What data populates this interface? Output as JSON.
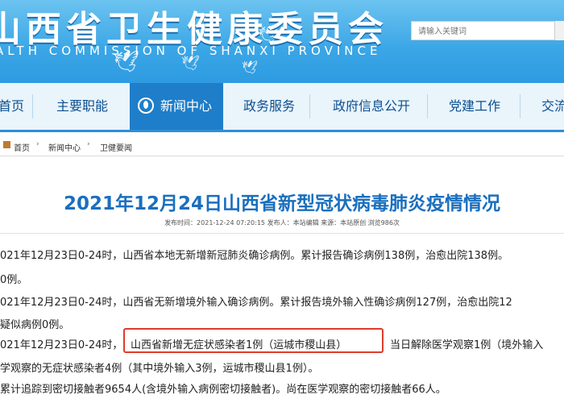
{
  "header": {
    "title_cn": "山西省卫生健康委员会",
    "title_en": "ALTH COMMISSION OF SHANXI PROVINCE",
    "search_placeholder": "请输入关键词"
  },
  "nav": {
    "items": [
      {
        "label": "首页"
      },
      {
        "label": "主要职能"
      },
      {
        "label": "新闻中心",
        "active": true
      },
      {
        "label": "政务服务"
      },
      {
        "label": "政府信息公开"
      },
      {
        "label": "党建工作"
      },
      {
        "label": "交流"
      }
    ]
  },
  "breadcrumb": {
    "items": [
      "首页",
      "新闻中心",
      "卫健要闻"
    ]
  },
  "article": {
    "title": "2021年12月24日山西省新型冠状病毒肺炎疫情情况",
    "meta": "发布时间：2021-12-24 07:20:15  发布人：本站编辑  来源：本站原创  浏览986次",
    "lines": [
      "021年12月23日0-24时，山西省本地无新增新冠肺炎确诊病例。累计报告确诊病例138例，治愈出院138例。",
      "0例。",
      "021年12月23日0-24时，山西省无新增境外输入确诊病例。累计报告境外输入性确诊病例127例，治愈出院12",
      "疑似病例0例。",
      "021年12月23日0-24时，",
      "山西省新增无症状感染者1例（运城市稷山县）",
      "当日解除医学观察1例（境外输入",
      "学观察的无症状感染者4例（其中境外输入3例，运城市稷山县1例）。",
      "累计追踪到密切接触者9654人(含境外输入病例密切接触者)。尚在医学观察的密切接触者66人。"
    ]
  },
  "colors": {
    "header_blue": "#3aa6e6",
    "nav_active": "#1f7ec9",
    "title_blue": "#1a6fbe",
    "highlight_red": "#e03b2b"
  }
}
